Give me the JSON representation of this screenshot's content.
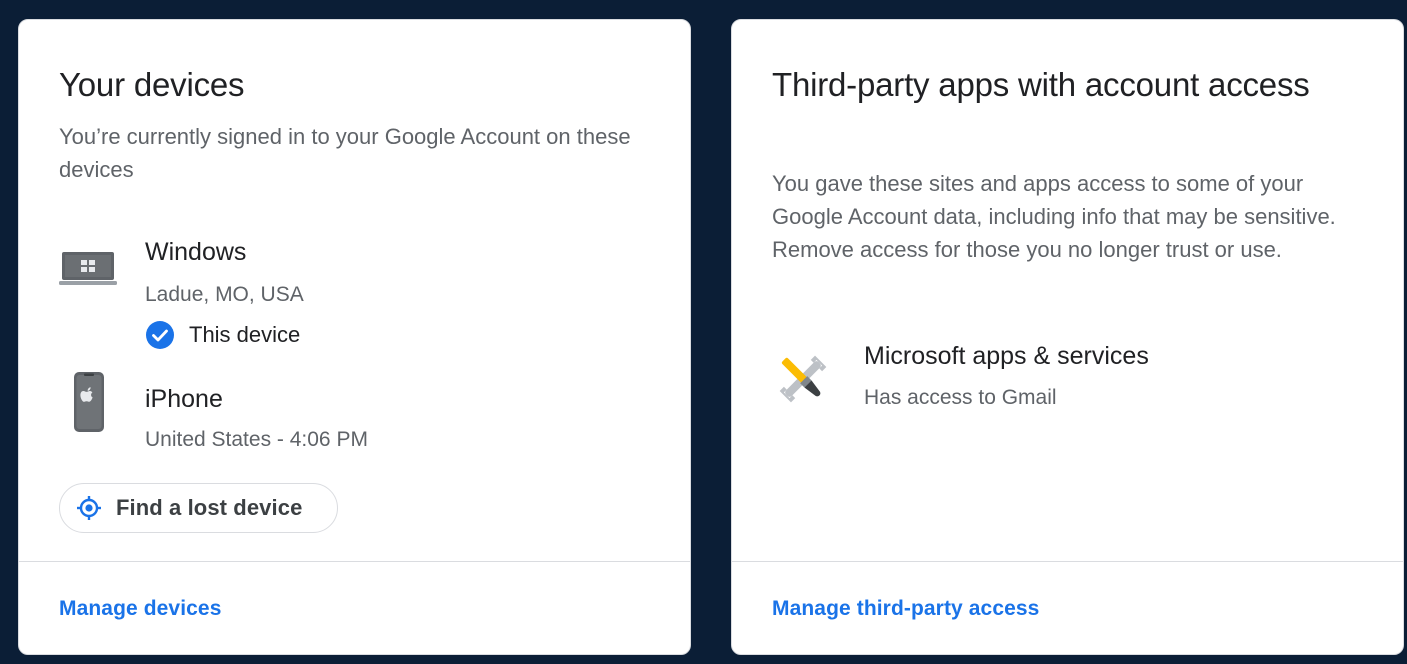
{
  "devices_card": {
    "title": "Your devices",
    "description": "You’re currently signed in to your Google Account on these devices",
    "devices": [
      {
        "name": "Windows",
        "location": "Ladue, MO, USA",
        "this_device_label": "This device",
        "icon": "laptop-windows-icon"
      },
      {
        "name": "iPhone",
        "location": "United States - 4:06 PM",
        "icon": "iphone-icon"
      }
    ],
    "find_button_label": "Find a lost device",
    "manage_link": "Manage devices"
  },
  "apps_card": {
    "title": "Third-party apps with account ac­cess",
    "description": "You gave these sites and apps access to some of your Google Account data, including info that may be sensi­tive. Remove access for those you no longer trust or use.",
    "apps": [
      {
        "name": "Microsoft apps & services",
        "access": "Has access to Gmail",
        "icon": "tools-icon"
      }
    ],
    "manage_link": "Manage third-party access"
  },
  "colors": {
    "background": "#0b1e36",
    "card": "#ffffff",
    "border": "#dadce0",
    "link_blue": "#1a73e8",
    "check_blue": "#1a73e8",
    "primary_text": "#202124",
    "secondary_text": "#5f6368"
  }
}
